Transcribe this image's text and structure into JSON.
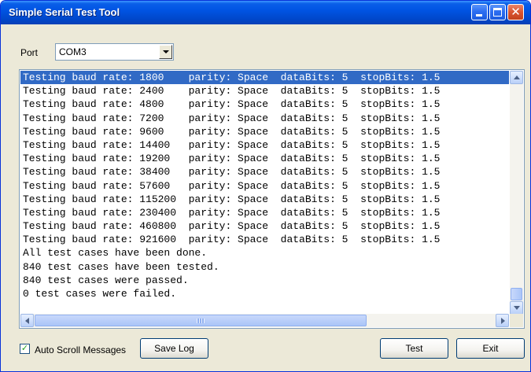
{
  "window": {
    "title": "Simple Serial Test Tool",
    "minimize_icon": "minimize-icon",
    "maximize_icon": "maximize-icon",
    "close_icon": "close-icon",
    "close_glyph": "✕"
  },
  "port": {
    "label": "Port",
    "selected": "COM3"
  },
  "log": {
    "lines": [
      "Testing baud rate: 1800    parity: Space  dataBits: 5  stopBits: 1.5",
      "Testing baud rate: 2400    parity: Space  dataBits: 5  stopBits: 1.5",
      "Testing baud rate: 4800    parity: Space  dataBits: 5  stopBits: 1.5",
      "Testing baud rate: 7200    parity: Space  dataBits: 5  stopBits: 1.5",
      "Testing baud rate: 9600    parity: Space  dataBits: 5  stopBits: 1.5",
      "Testing baud rate: 14400   parity: Space  dataBits: 5  stopBits: 1.5",
      "Testing baud rate: 19200   parity: Space  dataBits: 5  stopBits: 1.5",
      "Testing baud rate: 38400   parity: Space  dataBits: 5  stopBits: 1.5",
      "Testing baud rate: 57600   parity: Space  dataBits: 5  stopBits: 1.5",
      "Testing baud rate: 115200  parity: Space  dataBits: 5  stopBits: 1.5",
      "Testing baud rate: 230400  parity: Space  dataBits: 5  stopBits: 1.5",
      "Testing baud rate: 460800  parity: Space  dataBits: 5  stopBits: 1.5",
      "Testing baud rate: 921600  parity: Space  dataBits: 5  stopBits: 1.5",
      "All test cases have been done.",
      "840 test cases have been tested.",
      "840 test cases were passed.",
      "0 test cases were failed."
    ],
    "selected_index": 0
  },
  "options": {
    "auto_scroll_label": "Auto Scroll Messages",
    "auto_scroll_checked": true,
    "check_glyph": "✓"
  },
  "buttons": {
    "save_log": "Save Log",
    "test": "Test",
    "exit": "Exit"
  },
  "colors": {
    "titlebar": "#0054e3",
    "selection": "#316ac5",
    "window_bg": "#ece9d8"
  }
}
